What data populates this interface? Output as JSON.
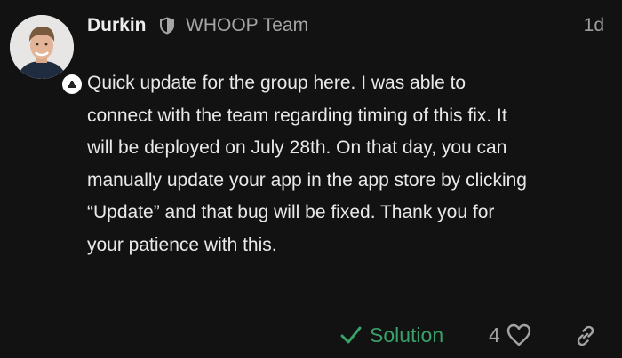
{
  "post": {
    "author": "Durkin",
    "team_label": "WHOOP Team",
    "timestamp": "1d",
    "body_lines": [
      "Quick update for the group here. I was able to",
      "connect with the team regarding timing of this fix. It",
      "will be deployed on July 28th. On that day, you can",
      "manually update your app in the app store by clicking",
      "“Update” and that bug will be fixed. Thank you for",
      "your patience with this."
    ],
    "icons": {
      "avatar": "avatar-photo",
      "badge": "whoop-badge-icon",
      "team": "shield-icon",
      "solution": "check-icon",
      "like": "heart-icon",
      "link": "link-icon"
    }
  },
  "footer": {
    "solution_label": "Solution",
    "like_count": "4"
  },
  "colors": {
    "background": "#121212",
    "text": "#e9e9e9",
    "muted": "#a5a5a5",
    "solution": "#3aa06a"
  }
}
